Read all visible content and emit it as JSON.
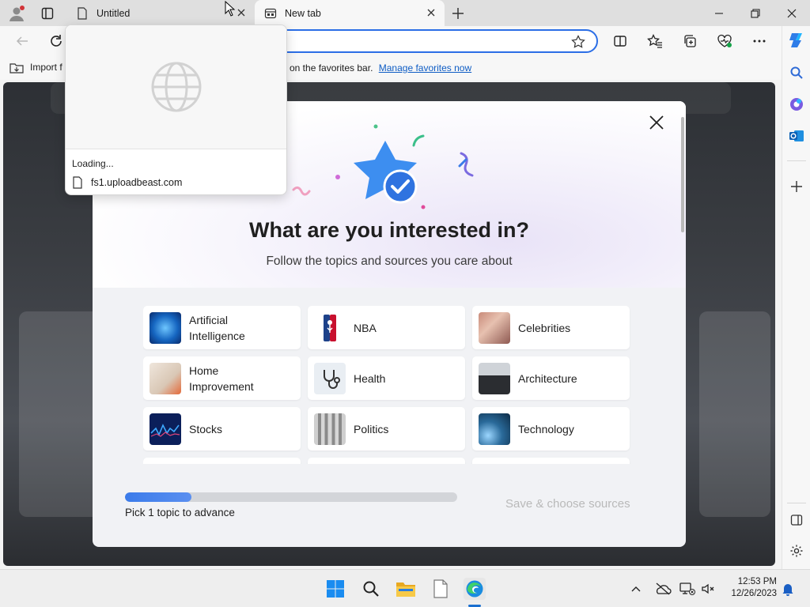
{
  "tabs": [
    {
      "title": "Untitled"
    },
    {
      "title": "New tab"
    }
  ],
  "favorites_bar": {
    "import_label": "Import f",
    "message": "re on the favorites bar.",
    "manage_link": "Manage favorites now"
  },
  "tab_popup": {
    "status": "Loading...",
    "url": "fs1.uploadbeast.com"
  },
  "modal": {
    "title": "What are you interested in?",
    "subtitle": "Follow the topics and sources you care about",
    "topics": [
      {
        "label": "Artificial Intelligence",
        "thumb": "ai"
      },
      {
        "label": "NBA",
        "thumb": "nba"
      },
      {
        "label": "Celebrities",
        "thumb": "celebrities"
      },
      {
        "label": "Home Improvement",
        "thumb": "home"
      },
      {
        "label": "Health",
        "thumb": "health"
      },
      {
        "label": "Architecture",
        "thumb": "architecture"
      },
      {
        "label": "Stocks",
        "thumb": "stocks"
      },
      {
        "label": "Politics",
        "thumb": "politics"
      },
      {
        "label": "Technology",
        "thumb": "technology"
      }
    ],
    "progress": {
      "value": 0.2,
      "label": "Pick 1 topic to advance"
    },
    "save_label": "Save & choose sources"
  },
  "taskbar": {
    "time": "12:53 PM",
    "date": "12/26/2023"
  },
  "colors": {
    "accent": "#2b6ee6",
    "link": "#0e5cc4",
    "progress": "#3b7bea"
  }
}
